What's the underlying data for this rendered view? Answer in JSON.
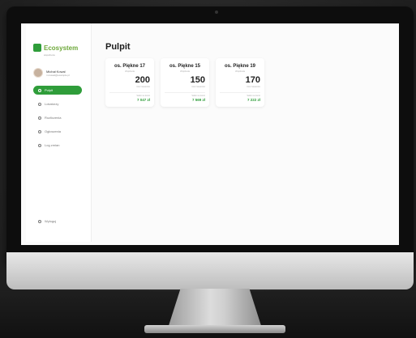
{
  "app": {
    "name": "Ecosystem",
    "tagline": "wspólnota"
  },
  "user": {
    "name": "Michał Kowal",
    "email": "m.kowal@example.pl"
  },
  "sidebar": {
    "items": [
      {
        "label": "Pulpit",
        "icon": "home-icon",
        "active": true
      },
      {
        "label": "Lokatorzy",
        "icon": "users-icon",
        "active": false
      },
      {
        "label": "Rozliczenia",
        "icon": "calc-icon",
        "active": false
      },
      {
        "label": "Ogłoszenia",
        "icon": "bell-icon",
        "active": false
      },
      {
        "label": "Log zmian",
        "icon": "list-icon",
        "active": false
      }
    ],
    "logout_label": "Wyloguj"
  },
  "main": {
    "title": "Pulpit",
    "cards": [
      {
        "title": "os. Piękne 17",
        "subtitle": "Wspólnota",
        "value": "200",
        "value_label": "Ilość lokatorów",
        "foot_label": "Saldo na konto",
        "amount": "7 047 zł"
      },
      {
        "title": "os. Piękne 15",
        "subtitle": "Wspólnota",
        "value": "150",
        "value_label": "Ilość lokatorów",
        "foot_label": "Saldo na konto",
        "amount": "7 569 zł"
      },
      {
        "title": "os. Piękne 19",
        "subtitle": "Wspólnota",
        "value": "170",
        "value_label": "Ilość lokatorów",
        "foot_label": "Saldo na konto",
        "amount": "7 222 zł"
      }
    ]
  },
  "colors": {
    "accent": "#2f9d3a",
    "logo": "#6da83a",
    "monitor": "#0d0d0d",
    "background": "#2a2a2a"
  }
}
